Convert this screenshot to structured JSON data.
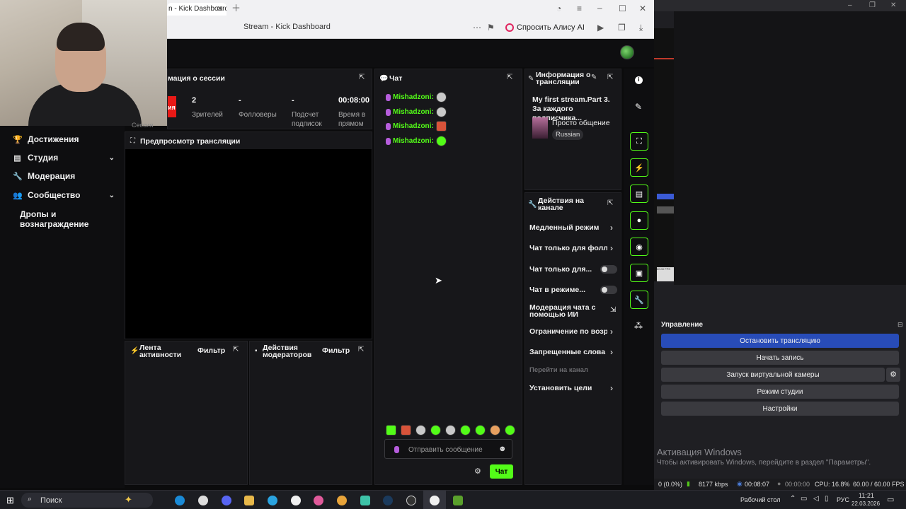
{
  "browser": {
    "tab_title": "n - Kick Dashboard",
    "address_title": "Stream - Kick Dashboard",
    "alice_label": "Спросить Алису AI"
  },
  "sidebar": {
    "items": [
      {
        "label": "Достижения",
        "icon": "trophy-icon"
      },
      {
        "label": "Студия",
        "icon": "studio-icon",
        "expandable": true
      },
      {
        "label": "Модерация",
        "icon": "wrench-icon"
      },
      {
        "label": "Сообщество",
        "icon": "community-icon",
        "expandable": true
      },
      {
        "label": "Дропы и вознаграждение",
        "icon": ""
      }
    ],
    "cut_label": "Сессия"
  },
  "session": {
    "title": "мация о сессии",
    "badge": "ия",
    "stats": [
      {
        "value": "2",
        "label": "Зрителей"
      },
      {
        "value": "-",
        "label": "Фолловеры"
      },
      {
        "value": "-",
        "label": "Подсчет подписок"
      },
      {
        "value": "00:08:00",
        "label": "Время в прямом"
      }
    ]
  },
  "preview": {
    "title": "Предпросмотр трансляции"
  },
  "activity": {
    "title": "Лента активности",
    "filter": "Фильтр"
  },
  "mod_actions": {
    "title": "Действия модераторов",
    "filter": "Фильтр"
  },
  "chat": {
    "title": "Чат",
    "messages": [
      {
        "user": "Mishadzoni:",
        "emote_color": "#c9c9c9"
      },
      {
        "user": "Mishadzoni:",
        "emote_color": "#c9c9c9"
      },
      {
        "user": "Mishadzoni:",
        "emote_color": "#d8533a"
      },
      {
        "user": "Mishadzoni:",
        "emote_color": "#53fc18"
      }
    ],
    "input_placeholder": "Отправить сообщение",
    "send_label": "Чат"
  },
  "stream_info": {
    "title": "Информация о трансляции",
    "stream_title": "My first stream.Part 3. За каждого подписчика...",
    "category": "Просто общение",
    "language": "Russian"
  },
  "channel_actions": {
    "title": "Действия на канале",
    "items": [
      {
        "label": "Медленный режим",
        "control": "arrow"
      },
      {
        "label": "Чат только для фолловеров",
        "control": "arrow"
      },
      {
        "label": "Чат только для...",
        "control": "toggle"
      },
      {
        "label": "Чат в режиме...",
        "control": "toggle"
      },
      {
        "label": "Модерация чата с помощью ИИ",
        "control": "external"
      },
      {
        "label": "Ограничение по возрасту",
        "control": "arrow"
      },
      {
        "label": "Запрещенные слова",
        "control": "arrow"
      },
      {
        "label": "Перейти на канал",
        "control": "none"
      },
      {
        "label": "Установить цели",
        "control": "arrow"
      }
    ]
  },
  "obs": {
    "controls_title": "Управление",
    "buttons": [
      "Остановить трансляцию",
      "Начать запись",
      "Запуск виртуальной камеры",
      "Режим студии",
      "Настройки"
    ],
    "fps_label": "60.00 FPS",
    "watermark_title": "Активация Windows",
    "watermark_text": "Чтобы активировать Windows, перейдите в раздел \"Параметры\".",
    "status": {
      "dropped": "0 (0.0%)",
      "bitrate": "8177 kbps",
      "live_time": "00:08:07",
      "rec_time": "00:00:00",
      "cpu": "CPU: 16.8%",
      "fps": "60.00 / 60.00 FPS"
    }
  },
  "taskbar": {
    "search_label": "Поиск",
    "desktop_label": "Рабочий стол",
    "lang": "РУС",
    "time": "11:21",
    "date": "22.03.2026"
  },
  "colors": {
    "accent": "#53fc18",
    "obs_primary": "#284cb8",
    "live_red": "#e91916"
  }
}
